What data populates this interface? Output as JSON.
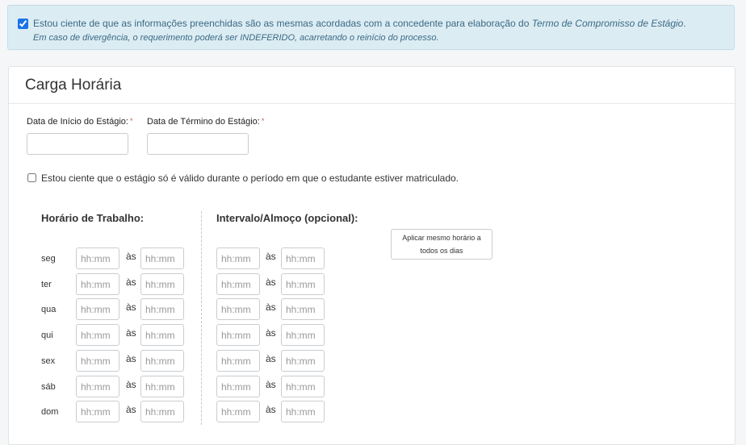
{
  "alert": {
    "line1_prefix": "Estou ciente de que as informações preenchidas são as mesmas acordadas com a concedente para elaboração do ",
    "line1_italic": "Termo de Compromisso de Estágio",
    "line1_suffix": ".",
    "line2": "Em caso de divergência, o requerimento poderá ser INDEFERIDO, acarretando o reinício do processo.",
    "checked": true
  },
  "section": {
    "title": "Carga Horária",
    "start_label": "Data de Início do Estágio:",
    "end_label": "Data de Término do Estágio:",
    "required_mark": "*",
    "enrollment_text": "Estou ciente que o estágio só é válido durante o período em que o estudante estiver matriculado."
  },
  "schedule": {
    "work_header": "Horário de Trabalho:",
    "lunch_header": "Intervalo/Almoço (opcional):",
    "apply_button": "Aplicar mesmo horário a todos os dias",
    "separator": "às",
    "placeholder": "hh:mm",
    "days": [
      "seg",
      "ter",
      "qua",
      "qui",
      "sex",
      "sáb",
      "dom"
    ]
  }
}
